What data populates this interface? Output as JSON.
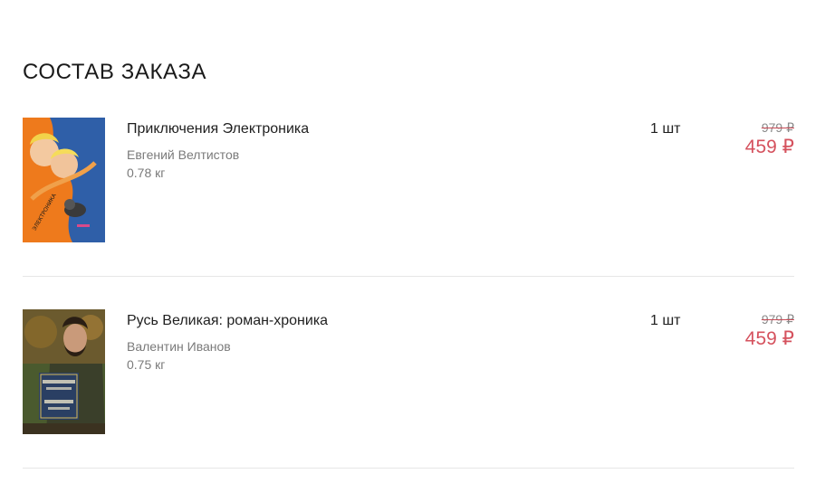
{
  "order": {
    "title": "СОСТАВ ЗАКАЗА",
    "items": [
      {
        "title": "Приключения Электроника",
        "author": "Евгений Велтистов",
        "weight": "0.78 кг",
        "quantity": "1 шт",
        "old_price": "979 ₽",
        "price": "459 ₽",
        "cover_colors": {
          "primary": "#ee7a1c",
          "secondary": "#2f5fa8"
        }
      },
      {
        "title": "Русь Великая: роман-хроника",
        "author": "Валентин Иванов",
        "weight": "0.75 кг",
        "quantity": "1 шт",
        "old_price": "979 ₽",
        "price": "459 ₽",
        "cover_colors": {
          "primary": "#4a5a2e",
          "secondary": "#2a3f63"
        }
      }
    ]
  },
  "colors": {
    "price_accent": "#d5525e",
    "muted_text": "#7a7a7a",
    "divider": "#e6e6e6"
  }
}
